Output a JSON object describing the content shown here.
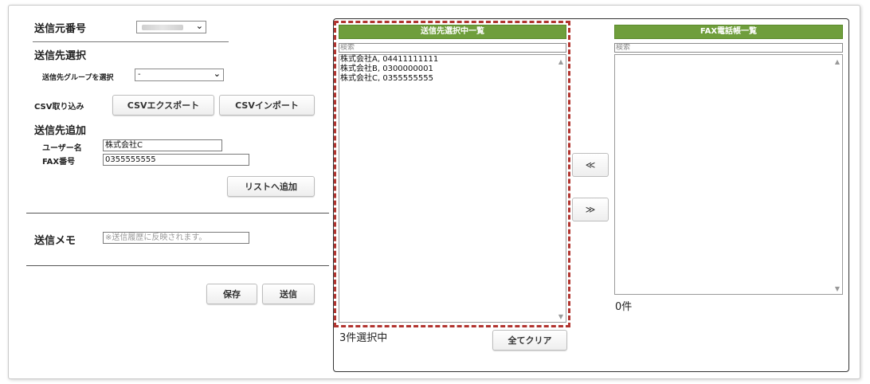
{
  "sender": {
    "label": "送信元番号",
    "value": ""
  },
  "dest_select": {
    "heading": "送信先選択",
    "group_label": "送信先グループを選択",
    "group_value": "-"
  },
  "csv": {
    "label": "CSV取り込み",
    "export_label": "CSVエクスポート",
    "import_label": "CSVインポート"
  },
  "dest_add": {
    "heading": "送信先追加",
    "username_label": "ユーザー名",
    "username_value": "株式会社C",
    "fax_label": "FAX番号",
    "fax_value": "0355555555",
    "add_button": "リストへ追加"
  },
  "memo": {
    "label": "送信メモ",
    "placeholder": "※送信履歴に反映されます。"
  },
  "actions": {
    "save": "保存",
    "send": "送信"
  },
  "selected_list": {
    "title": "送信先選択中一覧",
    "search_placeholder": "検索",
    "items": [
      "株式会社A, 04411111111",
      "株式会社B, 0300000001",
      "株式会社C, 0355555555"
    ],
    "count_text": "3件選択中",
    "clear_button": "全てクリア"
  },
  "transfer": {
    "left_arrow": "≪",
    "right_arrow": "≫"
  },
  "phonebook": {
    "title": "FAX電話帳一覧",
    "search_placeholder": "検索",
    "items": [],
    "count_text": "0件"
  },
  "colors": {
    "header_green": "#6f9e3c",
    "highlight_red": "#b1342f"
  }
}
